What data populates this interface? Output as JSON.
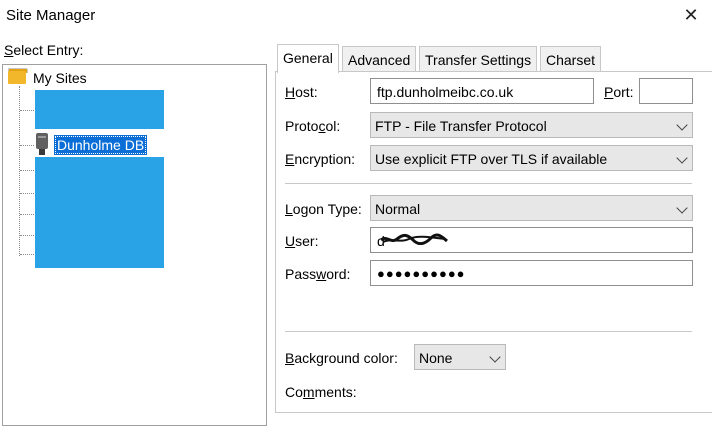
{
  "window": {
    "title": "Site Manager",
    "close_glyph": "✕"
  },
  "left": {
    "select_label_pre": "",
    "select_label_u": "S",
    "select_label_post": "elect Entry:",
    "tree": {
      "root_label": "My Sites",
      "selected_label": "Dunholme DB"
    }
  },
  "tabs": [
    {
      "label": "General"
    },
    {
      "label": "Advanced"
    },
    {
      "label": "Transfer Settings"
    },
    {
      "label": "Charset"
    }
  ],
  "general": {
    "host": {
      "label_u": "H",
      "label_rest": "ost:",
      "value": "ftp.dunholmeibc.co.uk"
    },
    "port": {
      "label_u": "P",
      "label_rest": "ort:",
      "value": ""
    },
    "protocol": {
      "label_pre": "Proto",
      "label_u": "c",
      "label_post": "ol:",
      "value": "FTP - File Transfer Protocol"
    },
    "encryption": {
      "label_u": "E",
      "label_rest": "ncryption:",
      "value": "Use explicit FTP over TLS if available"
    },
    "logon_type": {
      "label_pre": "",
      "label_u": "L",
      "label_post": "ogon Type:",
      "value": "Normal"
    },
    "user": {
      "label_u": "U",
      "label_rest": "ser:",
      "value": "d"
    },
    "password": {
      "label_pre": "Pass",
      "label_u": "w",
      "label_post": "ord:",
      "value": "●●●●●●●●●●"
    },
    "background_color": {
      "label_u": "B",
      "label_rest": "ackground color:",
      "value": "None"
    },
    "comments": {
      "label_pre": "Co",
      "label_u": "m",
      "label_post": "ments:"
    }
  },
  "colors": {
    "selection": "#0a6ed6",
    "redaction": "#29a3e5",
    "folder": "#f2b72a"
  }
}
